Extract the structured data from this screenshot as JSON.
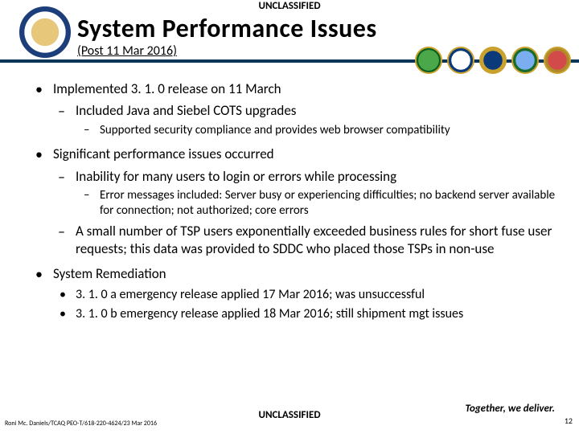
{
  "classification": "UNCLASSIFIED",
  "title": "System Performance Issues",
  "subtitle": "(Post 11 Mar 2016)",
  "bullets": {
    "b1": "Implemented 3. 1. 0 release on 11 March",
    "b1_1": "Included Java and Siebel COTS upgrades",
    "b1_1_1": "Supported security compliance and provides web browser compatibility",
    "b2": "Significant performance issues occurred",
    "b2_1": "Inability for many users to login or errors while processing",
    "b2_1_1": "Error messages included:  Server busy or experiencing difficulties; no backend server available for connection; not authorized; core errors",
    "b2_2": "A small number of TSP users exponentially exceeded business rules for short fuse user requests; this data was provided to SDDC who placed those TSPs in non-use",
    "b3": "System Remediation",
    "b3_1": "3. 1. 0 a emergency release applied 17 Mar 2016; was unsuccessful",
    "b3_2": "3. 1. 0 b emergency release applied 18 Mar 2016; still shipment mgt issues"
  },
  "footer": {
    "left": "Roni Mc. Daniels/TCAQ PEO-T/618-220-4624/23 Mar 2016",
    "center": "UNCLASSIFIED",
    "right": "Together, we deliver.",
    "page": "12"
  }
}
